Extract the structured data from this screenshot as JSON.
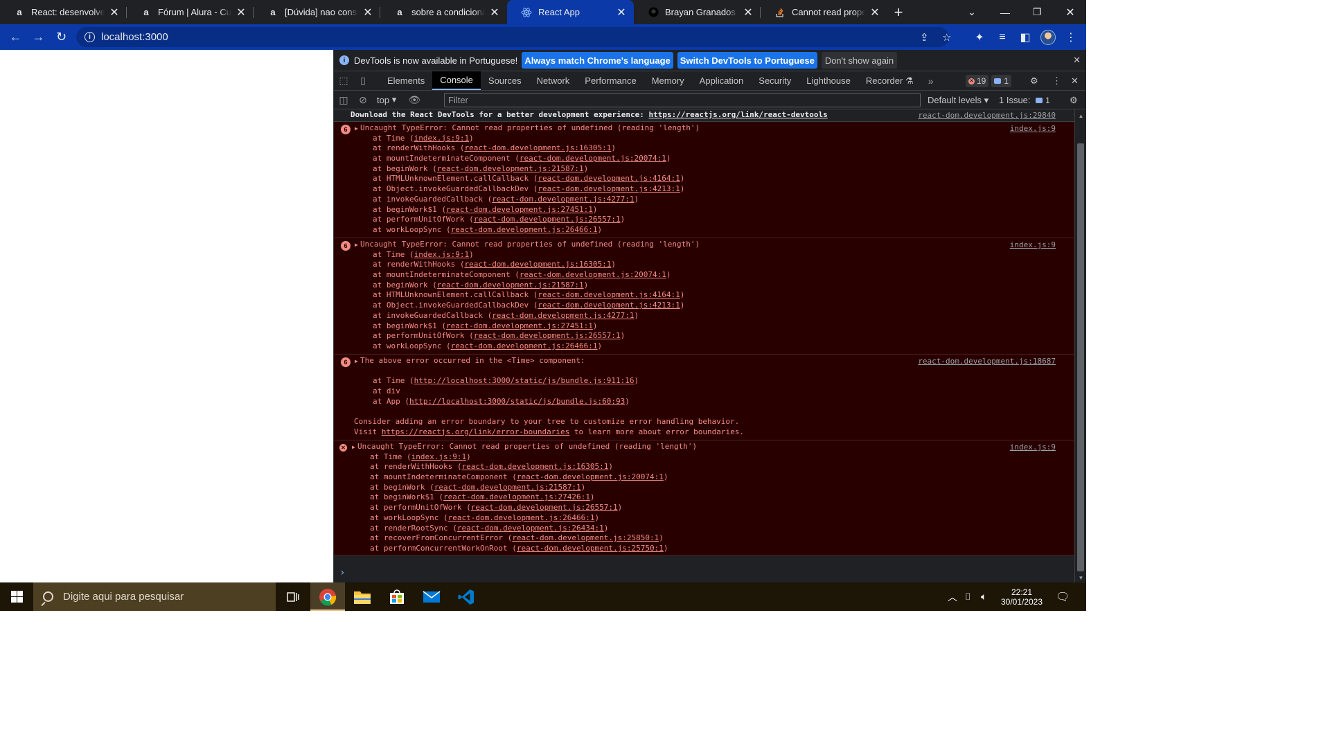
{
  "browser": {
    "tabs": [
      {
        "label": "React: desenvolvendo com JavaScript",
        "favicon": "alura-icon",
        "active": false
      },
      {
        "label": "Fórum | Alura - Cursos online",
        "favicon": "alura-icon",
        "active": false
      },
      {
        "label": "[Dúvida] nao consegui",
        "favicon": "alura-icon",
        "active": false
      },
      {
        "label": "sobre a condicional para",
        "favicon": "alura-icon",
        "active": false
      },
      {
        "label": "React App",
        "favicon": "react-icon",
        "active": true
      },
      {
        "label": "Brayan Granados (@a",
        "favicon": "github-icon",
        "active": false
      },
      {
        "label": "Cannot read properties",
        "favicon": "stackoverflow-icon",
        "active": false
      }
    ],
    "url": "localhost:3000"
  },
  "devtools": {
    "infobar": {
      "message": "DevTools is now available in Portuguese!",
      "btn_match": "Always match Chrome's language",
      "btn_switch": "Switch DevTools to Portuguese",
      "btn_dismiss": "Don't show again"
    },
    "tabs": [
      "Elements",
      "Console",
      "Sources",
      "Network",
      "Performance",
      "Memory",
      "Application",
      "Security",
      "Lighthouse",
      "Recorder"
    ],
    "active_tab": "Console",
    "error_count": "19",
    "message_count": "1",
    "context": "top",
    "filter_placeholder": "Filter",
    "levels": "Default levels",
    "issues_label": "1 Issue:",
    "issues_count": "1"
  },
  "console": {
    "info_line": {
      "prefix": "Download the React DevTools for a better development experience: ",
      "link": "https://reactjs.org/link/react-devtools",
      "source": "react-dom.development.js:29840"
    },
    "group1": {
      "count": "6",
      "message": "Uncaught TypeError: Cannot read properties of undefined (reading 'length')",
      "source": "index.js:9",
      "stack": [
        {
          "fn": "at Time (",
          "loc": "index.js:9:1",
          "end": ")"
        },
        {
          "fn": "at renderWithHooks (",
          "loc": "react-dom.development.js:16305:1",
          "end": ")"
        },
        {
          "fn": "at mountIndeterminateComponent (",
          "loc": "react-dom.development.js:20074:1",
          "end": ")"
        },
        {
          "fn": "at beginWork (",
          "loc": "react-dom.development.js:21587:1",
          "end": ")"
        },
        {
          "fn": "at HTMLUnknownElement.callCallback (",
          "loc": "react-dom.development.js:4164:1",
          "end": ")"
        },
        {
          "fn": "at Object.invokeGuardedCallbackDev (",
          "loc": "react-dom.development.js:4213:1",
          "end": ")"
        },
        {
          "fn": "at invokeGuardedCallback (",
          "loc": "react-dom.development.js:4277:1",
          "end": ")"
        },
        {
          "fn": "at beginWork$1 (",
          "loc": "react-dom.development.js:27451:1",
          "end": ")"
        },
        {
          "fn": "at performUnitOfWork (",
          "loc": "react-dom.development.js:26557:1",
          "end": ")"
        },
        {
          "fn": "at workLoopSync (",
          "loc": "react-dom.development.js:26466:1",
          "end": ")"
        }
      ]
    },
    "group2": {
      "count": "6",
      "message": "Uncaught TypeError: Cannot read properties of undefined (reading 'length')",
      "source": "index.js:9",
      "stack": [
        {
          "fn": "at Time (",
          "loc": "index.js:9:1",
          "end": ")"
        },
        {
          "fn": "at renderWithHooks (",
          "loc": "react-dom.development.js:16305:1",
          "end": ")"
        },
        {
          "fn": "at mountIndeterminateComponent (",
          "loc": "react-dom.development.js:20074:1",
          "end": ")"
        },
        {
          "fn": "at beginWork (",
          "loc": "react-dom.development.js:21587:1",
          "end": ")"
        },
        {
          "fn": "at HTMLUnknownElement.callCallback (",
          "loc": "react-dom.development.js:4164:1",
          "end": ")"
        },
        {
          "fn": "at Object.invokeGuardedCallbackDev (",
          "loc": "react-dom.development.js:4213:1",
          "end": ")"
        },
        {
          "fn": "at invokeGuardedCallback (",
          "loc": "react-dom.development.js:4277:1",
          "end": ")"
        },
        {
          "fn": "at beginWork$1 (",
          "loc": "react-dom.development.js:27451:1",
          "end": ")"
        },
        {
          "fn": "at performUnitOfWork (",
          "loc": "react-dom.development.js:26557:1",
          "end": ")"
        },
        {
          "fn": "at workLoopSync (",
          "loc": "react-dom.development.js:26466:1",
          "end": ")"
        }
      ]
    },
    "group3": {
      "count": "6",
      "message": "The above error occurred in the <Time> component:",
      "source": "react-dom.development.js:18687",
      "stack": [
        {
          "fn": "at Time (",
          "loc": "http://localhost:3000/static/js/bundle.js:911:16",
          "end": ")"
        },
        {
          "fn": "at div",
          "loc": "",
          "end": ""
        },
        {
          "fn": "at App (",
          "loc": "http://localhost:3000/static/js/bundle.js:60:93",
          "end": ")"
        }
      ],
      "advice1": "Consider adding an error boundary to your tree to customize error handling behavior.",
      "advice2_pre": "Visit ",
      "advice2_link": "https://reactjs.org/link/error-boundaries",
      "advice2_post": " to learn more about error boundaries."
    },
    "group4": {
      "message": "Uncaught TypeError: Cannot read properties of undefined (reading 'length')",
      "source": "index.js:9",
      "stack": [
        {
          "fn": "at Time (",
          "loc": "index.js:9:1",
          "end": ")"
        },
        {
          "fn": "at renderWithHooks (",
          "loc": "react-dom.development.js:16305:1",
          "end": ")"
        },
        {
          "fn": "at mountIndeterminateComponent (",
          "loc": "react-dom.development.js:20074:1",
          "end": ")"
        },
        {
          "fn": "at beginWork (",
          "loc": "react-dom.development.js:21587:1",
          "end": ")"
        },
        {
          "fn": "at beginWork$1 (",
          "loc": "react-dom.development.js:27426:1",
          "end": ")"
        },
        {
          "fn": "at performUnitOfWork (",
          "loc": "react-dom.development.js:26557:1",
          "end": ")"
        },
        {
          "fn": "at workLoopSync (",
          "loc": "react-dom.development.js:26466:1",
          "end": ")"
        },
        {
          "fn": "at renderRootSync (",
          "loc": "react-dom.development.js:26434:1",
          "end": ")"
        },
        {
          "fn": "at recoverFromConcurrentError (",
          "loc": "react-dom.development.js:25850:1",
          "end": ")"
        },
        {
          "fn": "at performConcurrentWorkOnRoot (",
          "loc": "react-dom.development.js:25750:1",
          "end": ")"
        }
      ]
    },
    "prompt": "›"
  },
  "taskbar": {
    "search_placeholder": "Digite aqui para pesquisar",
    "time": "22:21",
    "date": "30/01/2023"
  },
  "colors": {
    "toolbar": "#0b3aa8",
    "error_text": "#f28b82",
    "error_bg": "#290000",
    "taskbar": "#1d1607"
  }
}
